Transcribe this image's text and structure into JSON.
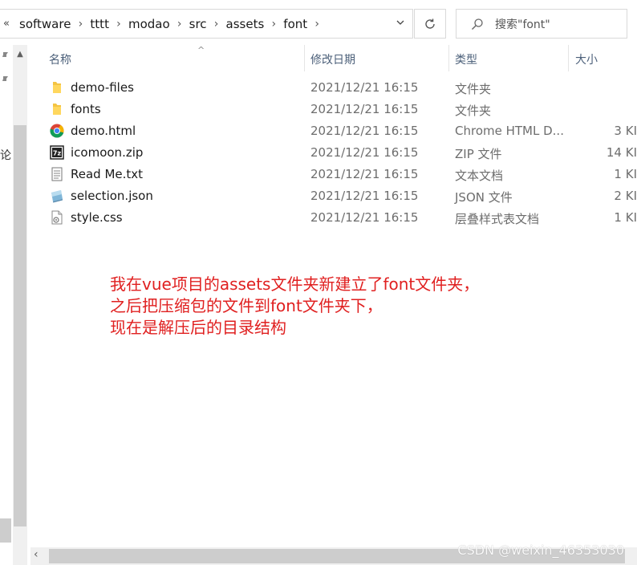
{
  "address": {
    "overflow": "«",
    "segments": [
      "software",
      "tttt",
      "modao",
      "src",
      "assets",
      "font"
    ],
    "separator": "›"
  },
  "search": {
    "placeholder": "搜索\"font\""
  },
  "nav": {
    "cut_text": "论"
  },
  "columns": {
    "name": "名称",
    "date": "修改日期",
    "type": "类型",
    "size": "大小"
  },
  "files": [
    {
      "name": "demo-files",
      "date": "2021/12/21 16:15",
      "type": "文件夹",
      "size": "",
      "icon": "folder-icon"
    },
    {
      "name": "fonts",
      "date": "2021/12/21 16:15",
      "type": "文件夹",
      "size": "",
      "icon": "folder-icon"
    },
    {
      "name": "demo.html",
      "date": "2021/12/21 16:15",
      "type": "Chrome HTML D...",
      "size": "3 KI",
      "icon": "chrome-icon"
    },
    {
      "name": "icomoon.zip",
      "date": "2021/12/21 16:15",
      "type": "ZIP 文件",
      "size": "14 KI",
      "icon": "7zip-icon"
    },
    {
      "name": "Read Me.txt",
      "date": "2021/12/21 16:15",
      "type": "文本文档",
      "size": "1 KI",
      "icon": "text-file-icon"
    },
    {
      "name": "selection.json",
      "date": "2021/12/21 16:15",
      "type": "JSON 文件",
      "size": "2 KI",
      "icon": "json-file-icon"
    },
    {
      "name": "style.css",
      "date": "2021/12/21 16:15",
      "type": "层叠样式表文档",
      "size": "1 KI",
      "icon": "css-file-icon"
    }
  ],
  "annotation": {
    "lines": [
      "我在vue项目的assets文件夹新建立了font文件夹，",
      "之后把压缩包的文件到font文件夹下，",
      "现在是解压后的目录结构"
    ],
    "color": "#e02020"
  },
  "watermark": "CSDN @weixin_46353030"
}
